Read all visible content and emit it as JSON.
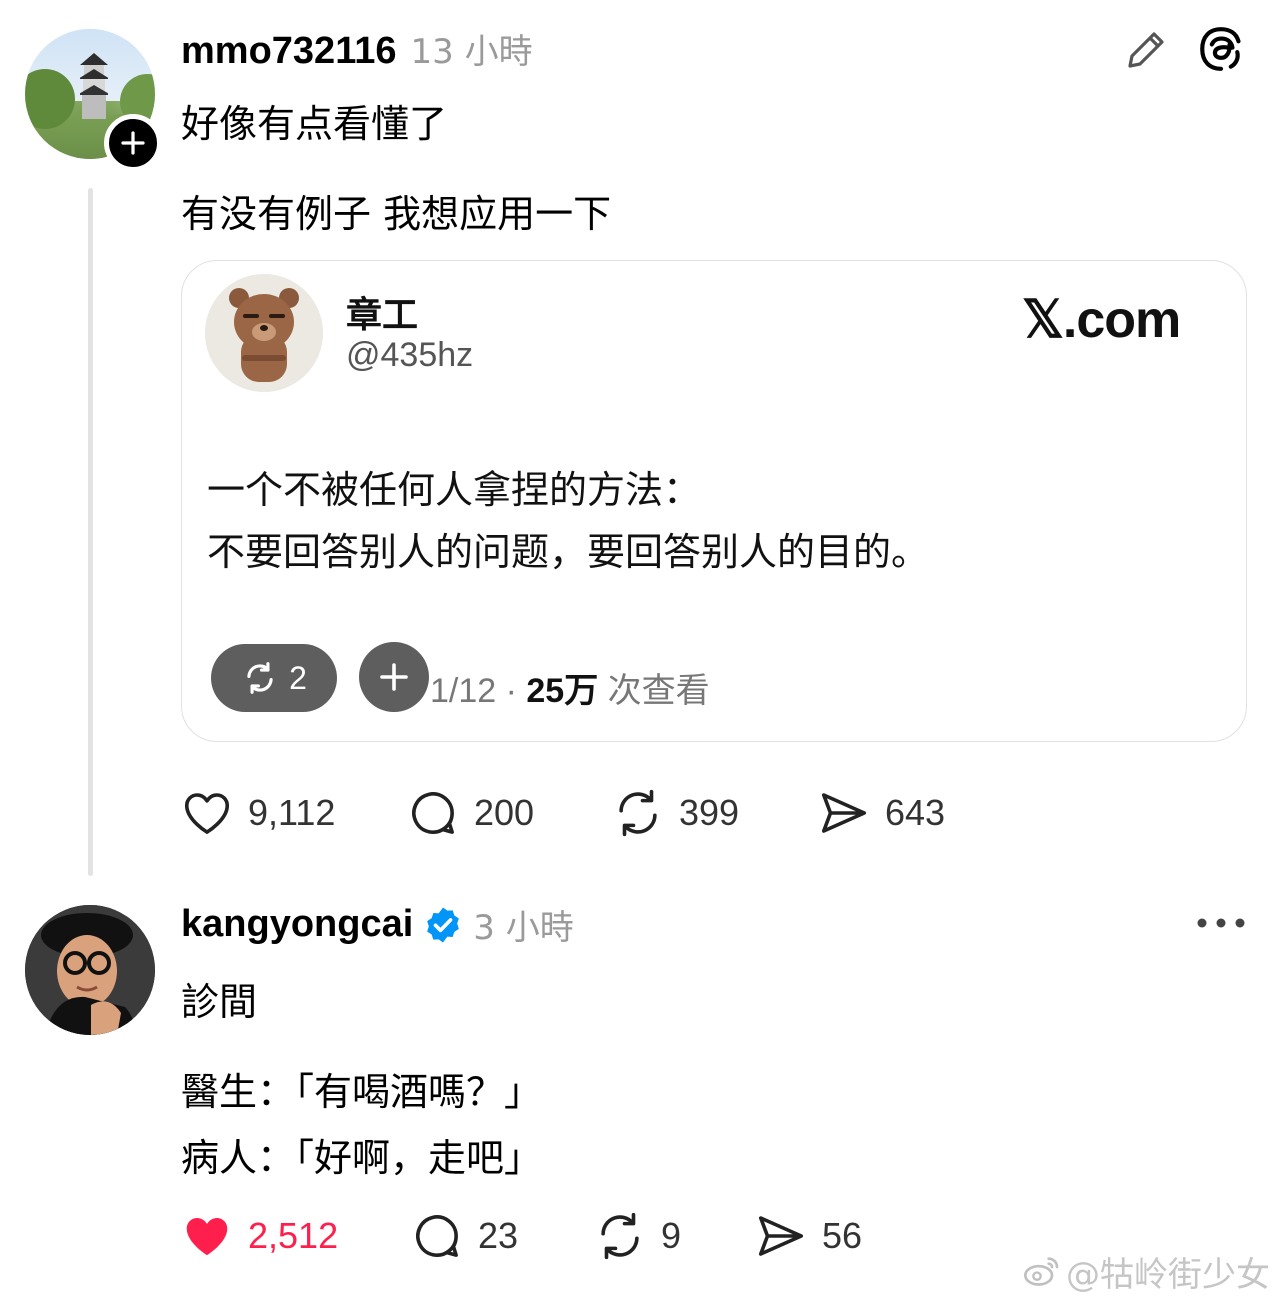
{
  "post1": {
    "username": "mmo732116",
    "time": "13 小時",
    "line1": "好像有点看懂了",
    "line2": "有没有例子 我想应用一下",
    "quote": {
      "name": "章工",
      "handle": "@435hz",
      "site": "𝕏.com",
      "body_line1": "一个不被任何人拿捏的方法：",
      "body_line2": "不要回答别人的问题，要回答别人的目的。",
      "footer_date": "1/12 · ",
      "footer_views": "25万",
      "footer_views_label": " 次查看",
      "repost_count": "2"
    },
    "actions": {
      "likes": "9,112",
      "comments": "200",
      "reposts": "399",
      "shares": "643"
    }
  },
  "post2": {
    "username": "kangyongcai",
    "time": "3 小時",
    "line1": "診間",
    "line2": "醫生：「有喝酒嗎？」",
    "line3": "病人：「好啊，走吧」",
    "actions": {
      "likes": "2,512",
      "comments": "23",
      "reposts": "9",
      "shares": "56"
    }
  },
  "watermark": "@牯岭街少女",
  "colors": {
    "like_active": "#ff1f4c",
    "verified": "#0095f6",
    "muted": "#9a9a9a"
  }
}
